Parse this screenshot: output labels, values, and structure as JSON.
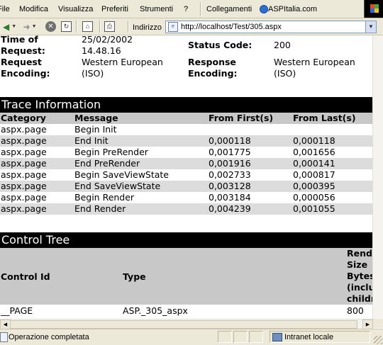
{
  "menu": {
    "items": [
      "File",
      "Modifica",
      "Visualizza",
      "Preferiti",
      "Strumenti",
      "?"
    ],
    "links_label": "Collegamenti",
    "links_item": "ASPItalia.com"
  },
  "toolbar": {
    "back_label": "Indietro",
    "address_label": "Indirizzo",
    "url": "http://localhost/Test/305.aspx"
  },
  "request_details": {
    "time_label": "Time of Request:",
    "time_value_date": "25/02/2002",
    "time_value_time": "14.48.16",
    "status_label": "Status Code:",
    "status_value": "200",
    "req_enc_label_1": "Request",
    "req_enc_label_2": "Encoding:",
    "req_enc_value_1": "Western European",
    "req_enc_value_2": "(ISO)",
    "resp_enc_label_1": "Response",
    "resp_enc_label_2": "Encoding:",
    "resp_enc_value_1": "Western European",
    "resp_enc_value_2": "(ISO)"
  },
  "trace": {
    "title": "Trace Information",
    "headers": [
      "Category",
      "Message",
      "From First(s)",
      "From Last(s)"
    ],
    "rows": [
      [
        "aspx.page",
        "Begin Init",
        "",
        ""
      ],
      [
        "aspx.page",
        "End Init",
        "0,000118",
        "0,000118"
      ],
      [
        "aspx.page",
        "Begin PreRender",
        "0,001775",
        "0,001656"
      ],
      [
        "aspx.page",
        "End PreRender",
        "0,001916",
        "0,000141"
      ],
      [
        "aspx.page",
        "Begin SaveViewState",
        "0,002733",
        "0,000817"
      ],
      [
        "aspx.page",
        "End SaveViewState",
        "0,003128",
        "0,000395"
      ],
      [
        "aspx.page",
        "Begin Render",
        "0,003184",
        "0,000056"
      ],
      [
        "aspx.page",
        "End Render",
        "0,004239",
        "0,001055"
      ]
    ]
  },
  "control_tree": {
    "title": "Control Tree",
    "col_id": "Control Id",
    "col_type": "Type",
    "col_size_lines": [
      "Render",
      "Size",
      "Bytes",
      "(includ",
      "childre"
    ],
    "rows": [
      [
        "__PAGE",
        "ASP._305_aspx",
        "800"
      ]
    ]
  },
  "status_bar": {
    "text": "Operazione completata",
    "zone": "Intranet locale"
  }
}
